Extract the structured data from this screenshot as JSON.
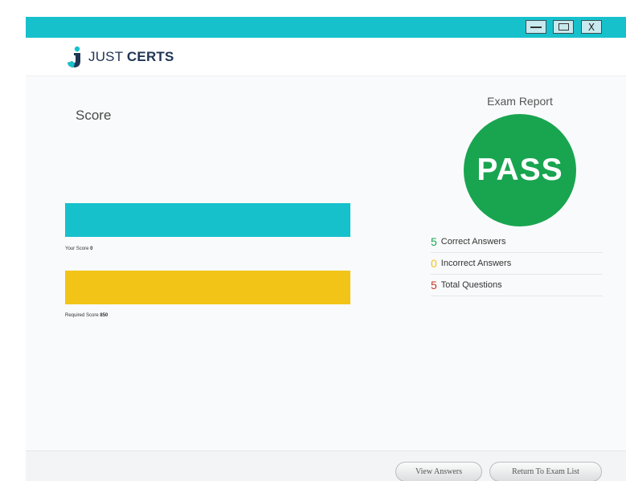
{
  "window": {
    "controls": {
      "minimize_icon": "minimize-icon",
      "maximize_icon": "maximize-icon",
      "close_label": "X"
    }
  },
  "header": {
    "logo_light": "JUST ",
    "logo_bold": "CERTS",
    "logo_icon": "just-certs-logo-icon"
  },
  "score": {
    "title": "Score",
    "your_score_label": "Your Score",
    "your_score_value": "0",
    "required_score_label": "Required Score",
    "required_score_value": "850"
  },
  "report": {
    "title": "Exam Report",
    "result": "PASS",
    "stats": [
      {
        "value": "5",
        "label": "Correct Answers",
        "color": "#19a550"
      },
      {
        "value": "0",
        "label": "Incorrect Answers",
        "color": "#f2c417"
      },
      {
        "value": "5",
        "label": "Total Questions",
        "color": "#c0392b"
      }
    ]
  },
  "footer": {
    "view_answers": "View Answers",
    "return_to_exam_list": "Return To Exam List"
  },
  "colors": {
    "accent": "#17c1cc",
    "pass": "#19a550",
    "required_bar": "#f2c417"
  }
}
